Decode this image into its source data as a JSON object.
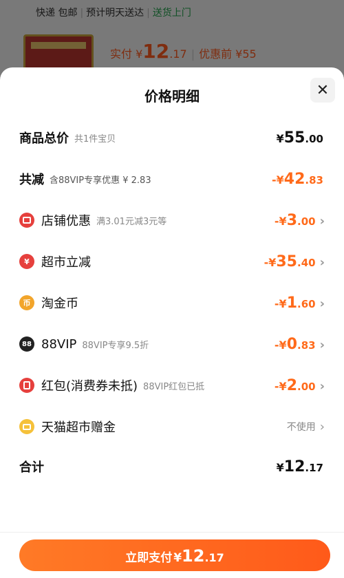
{
  "background": {
    "shipping": [
      "快递 包邮",
      "预计明天送达",
      "送货上门"
    ],
    "price_label": "实付 ¥",
    "price_int": "12",
    "price_dec": ".17",
    "orig_label": "优惠前 ¥55"
  },
  "sheet": {
    "title": "价格明细",
    "close_label": "✕",
    "total": {
      "label": "商品总价",
      "sub": "共1件宝贝",
      "yen": "¥",
      "int": "55",
      "dec": ".00"
    },
    "reduced": {
      "label": "共减",
      "sub": "含88VIP专享优惠 ¥ 2.83",
      "yen": "-¥",
      "int": "42",
      "dec": ".83"
    },
    "items": [
      {
        "label": "店铺优惠",
        "sub": "满3.01元减3元等",
        "yen": "-¥",
        "int": "3",
        "dec": ".00",
        "icon": "shop-icon"
      },
      {
        "label": "超市立减",
        "sub": "",
        "yen": "-¥",
        "int": "35",
        "dec": ".40",
        "icon": "supermarket-icon",
        "glyph": "¥"
      },
      {
        "label": "淘金币",
        "sub": "",
        "yen": "-¥",
        "int": "1",
        "dec": ".60",
        "icon": "coin-icon",
        "glyph": "币"
      },
      {
        "label": "88VIP",
        "sub": "88VIP专享9.5折",
        "yen": "-¥",
        "int": "0",
        "dec": ".83",
        "icon": "vip-icon",
        "glyph": "88"
      },
      {
        "label": "红包(消费券未抵)",
        "sub": "88VIP红包已抵",
        "yen": "-¥",
        "int": "2",
        "dec": ".00",
        "icon": "red-packet-icon"
      },
      {
        "label": "天猫超市赠金",
        "value": "不使用",
        "icon": "gift-icon"
      }
    ],
    "sum": {
      "label": "合计",
      "yen": "¥",
      "int": "12",
      "dec": ".17"
    },
    "chevron": "›"
  },
  "pay_button": {
    "label": "立即支付",
    "yen": "¥",
    "int": "12",
    "dec": ".17"
  },
  "colors": {
    "accent": "#ff6a1a",
    "red": "#e6403d",
    "gold": "#f2a52b",
    "green": "#21a04a"
  }
}
